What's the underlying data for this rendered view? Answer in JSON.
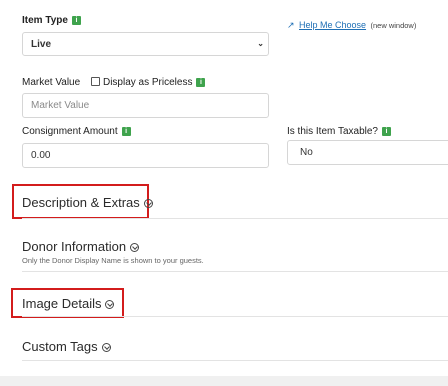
{
  "item_type": {
    "label": "Item Type",
    "value": "Live"
  },
  "help": {
    "link_text": "Help Me Choose",
    "note": "(new window)"
  },
  "market_value": {
    "label": "Market Value",
    "priceless_label": "Display as Priceless",
    "placeholder": "Market Value"
  },
  "consignment": {
    "label": "Consignment Amount",
    "value": "0.00"
  },
  "taxable": {
    "label": "Is this Item Taxable?",
    "value": "No"
  },
  "sections": {
    "description": "Description & Extras",
    "donor": "Donor Information",
    "donor_note": "Only the Donor Display Name is shown to your guests.",
    "image": "Image Details",
    "custom_tags": "Custom Tags"
  },
  "info_glyph": "i",
  "colors": {
    "highlight": "#d31c1c",
    "info_badge": "#3fa34d",
    "link": "#1f6fb5"
  }
}
